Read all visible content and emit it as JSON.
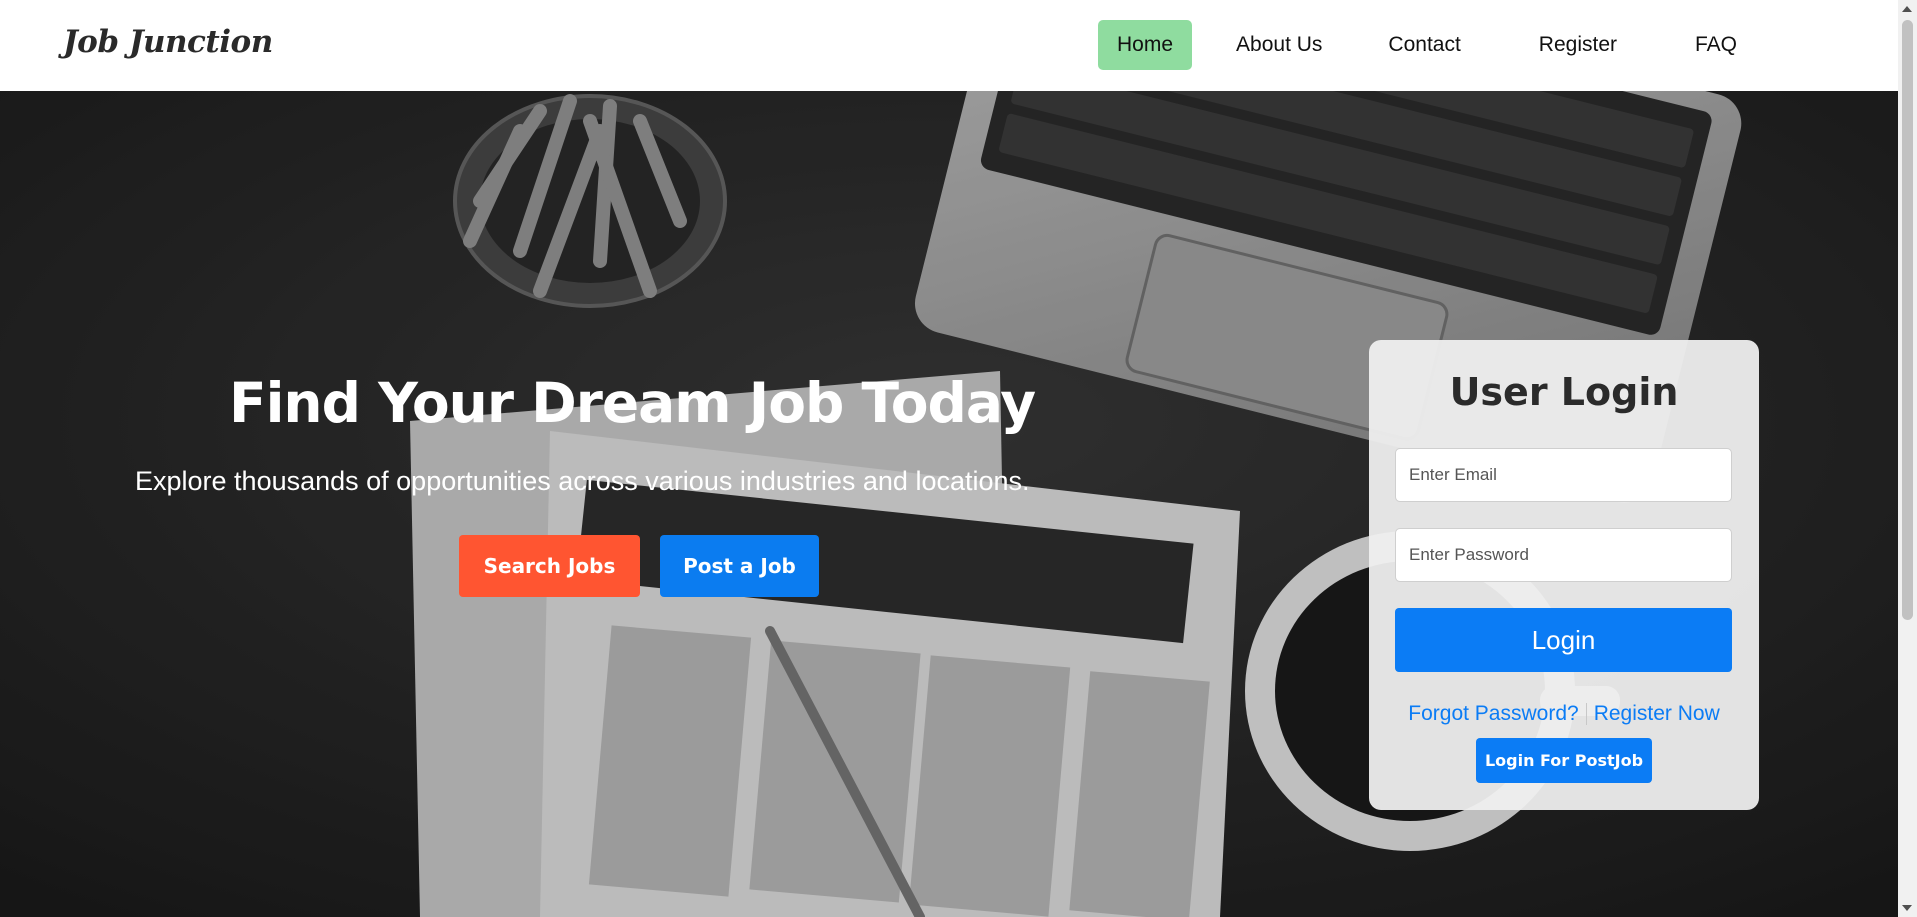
{
  "brand": {
    "logo": "Job Junction"
  },
  "nav": {
    "items": [
      {
        "label": "Home",
        "active": true
      },
      {
        "label": "About Us",
        "active": false
      },
      {
        "label": "Contact",
        "active": false
      },
      {
        "label": "Register",
        "active": false
      },
      {
        "label": "FAQ",
        "active": false
      }
    ]
  },
  "hero": {
    "title": "Find Your Dream Job Today",
    "subtitle": "Explore thousands of opportunities across various industries and locations.",
    "search_button": "Search Jobs",
    "post_button": "Post a Job"
  },
  "login": {
    "title": "User Login",
    "email_placeholder": "Enter Email",
    "password_placeholder": "Enter Password",
    "login_button": "Login",
    "forgot_link": "Forgot Password?",
    "register_link": "Register Now",
    "postjob_button": "Login For PostJob"
  },
  "colors": {
    "nav_active": "#8fdc9f",
    "search_button": "#ff5531",
    "primary": "#0b7cf5"
  }
}
